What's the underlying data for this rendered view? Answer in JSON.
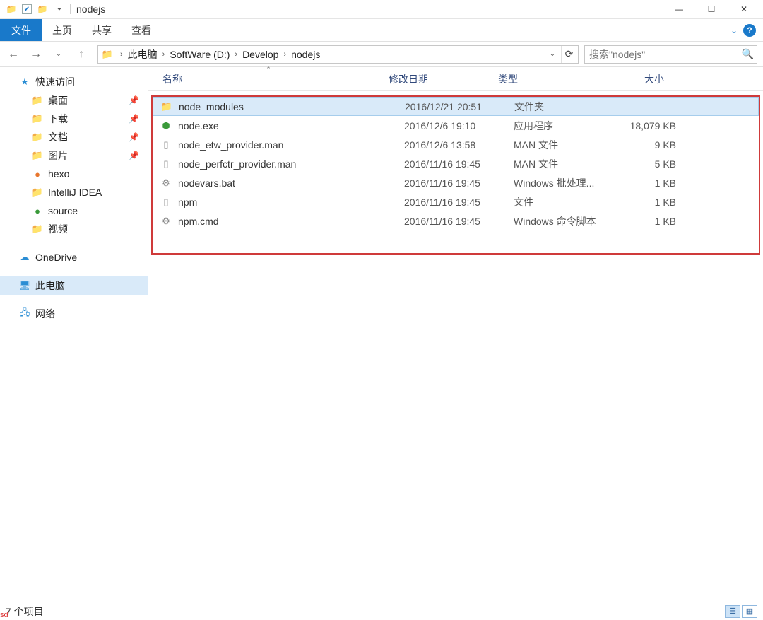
{
  "window": {
    "title": "nodejs"
  },
  "ribbon": {
    "file_tab": "文件",
    "tabs": [
      "主页",
      "共享",
      "查看"
    ],
    "chevron_tip": "v"
  },
  "nav": {
    "breadcrumbs": [
      "此电脑",
      "SoftWare (D:)",
      "Develop",
      "nodejs"
    ],
    "search_placeholder": "搜索\"nodejs\""
  },
  "sidebar": {
    "quick_access": "快速访问",
    "quick_items": [
      {
        "label": "桌面",
        "pinned": true,
        "icon": "folder"
      },
      {
        "label": "下载",
        "pinned": true,
        "icon": "folder"
      },
      {
        "label": "文档",
        "pinned": true,
        "icon": "folder"
      },
      {
        "label": "图片",
        "pinned": true,
        "icon": "folder"
      },
      {
        "label": "hexo",
        "pinned": false,
        "icon": "orange-dot"
      },
      {
        "label": "IntelliJ IDEA",
        "pinned": false,
        "icon": "folder"
      },
      {
        "label": "source",
        "pinned": false,
        "icon": "green-dot"
      },
      {
        "label": "视频",
        "pinned": false,
        "icon": "folder"
      }
    ],
    "onedrive": "OneDrive",
    "this_pc": "此电脑",
    "network": "网络"
  },
  "columns": {
    "name": "名称",
    "date": "修改日期",
    "type": "类型",
    "size": "大小"
  },
  "files": [
    {
      "name": "node_modules",
      "date": "2016/12/21 20:51",
      "type": "文件夹",
      "size": "",
      "icon": "folder",
      "selected": true
    },
    {
      "name": "node.exe",
      "date": "2016/12/6 19:10",
      "type": "应用程序",
      "size": "18,079 KB",
      "icon": "node"
    },
    {
      "name": "node_etw_provider.man",
      "date": "2016/12/6 13:58",
      "type": "MAN 文件",
      "size": "9 KB",
      "icon": "generic"
    },
    {
      "name": "node_perfctr_provider.man",
      "date": "2016/11/16 19:45",
      "type": "MAN 文件",
      "size": "5 KB",
      "icon": "generic"
    },
    {
      "name": "nodevars.bat",
      "date": "2016/11/16 19:45",
      "type": "Windows 批处理...",
      "size": "1 KB",
      "icon": "bat"
    },
    {
      "name": "npm",
      "date": "2016/11/16 19:45",
      "type": "文件",
      "size": "1 KB",
      "icon": "generic"
    },
    {
      "name": "npm.cmd",
      "date": "2016/11/16 19:45",
      "type": "Windows 命令脚本",
      "size": "1 KB",
      "icon": "bat"
    }
  ],
  "status": {
    "text": "7 个项目",
    "corner": "sd"
  }
}
